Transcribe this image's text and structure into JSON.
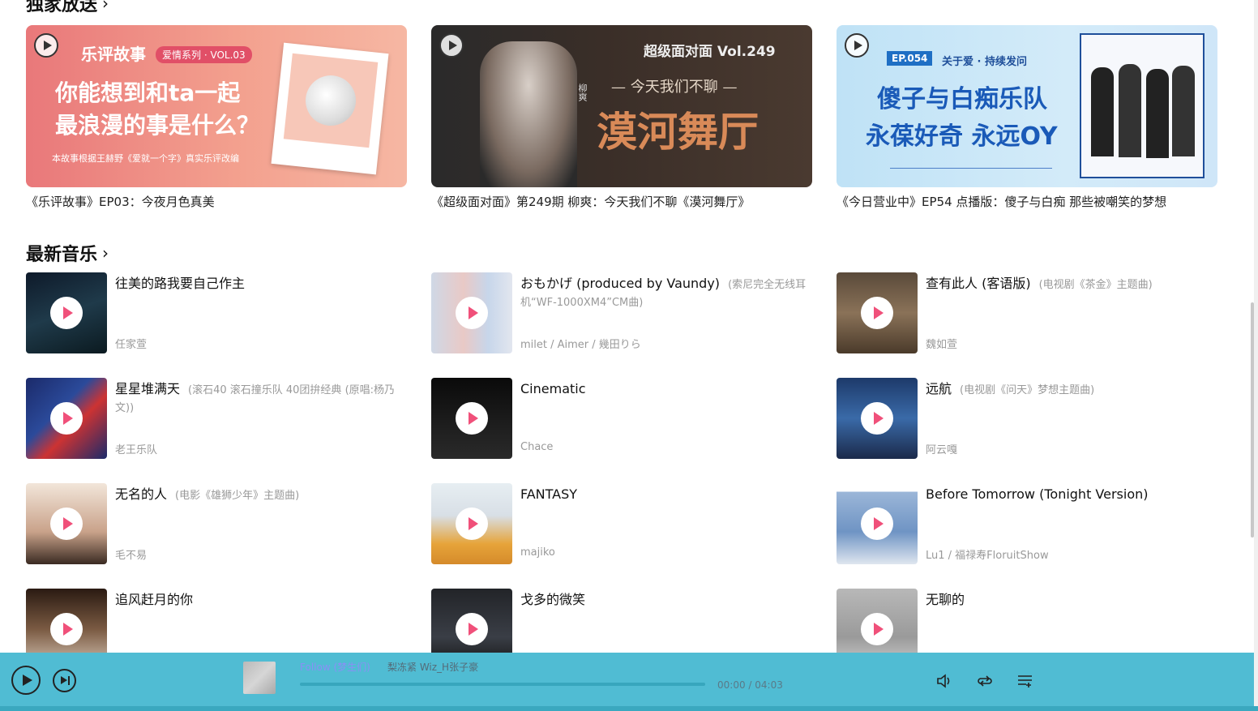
{
  "exclusive": {
    "title": "独家放送",
    "banners": [
      {
        "caption": "《乐评故事》EP03：今夜月色真美",
        "badge": "爱情系列 · VOL.03",
        "brand": "乐评故事",
        "line1": "你能想到和ta一起",
        "line2": "最浪漫的事是什么？",
        "note": "本故事根据王赫野《爱就一个字》真实乐评改编"
      },
      {
        "caption": "《超级面对面》第249期 柳爽：今天我们不聊《漠河舞厅》",
        "brand": "超级面对面 Vol.249",
        "line1": "— 今天我们不聊 —",
        "line2": "漠河舞厅",
        "name": "柳爽"
      },
      {
        "caption": "《今日营业中》EP54 点播版：傻子与白痴 那些被嘲笑的梦想",
        "badge": "EP.054",
        "tag": "关于爱 · 持续发问",
        "line1": "傻子与白痴乐队",
        "line2": "永葆好奇 永远OY"
      }
    ]
  },
  "newMusic": {
    "title": "最新音乐",
    "songs": [
      {
        "name": "往美的路我要自己作主",
        "sub": "",
        "artist": "任家萱"
      },
      {
        "name": "おもかげ (produced by Vaundy)",
        "sub": "(索尼完全无线耳机“WF-1000XM4”CM曲)",
        "artist": "milet / Aimer / 幾田りら"
      },
      {
        "name": "查有此人 (客语版)",
        "sub": "(电视剧《茶金》主题曲)",
        "artist": "魏如萱"
      },
      {
        "name": "星星堆满天",
        "sub": "(滚石40 滚石撞乐队 40团拚经典 (原唱:杨乃文))",
        "artist": "老王乐队"
      },
      {
        "name": "Cinematic",
        "sub": "",
        "artist": "Chace"
      },
      {
        "name": "远航",
        "sub": "(电视剧《问天》梦想主题曲)",
        "artist": "阿云嘎"
      },
      {
        "name": "无名的人",
        "sub": "(电影《雄狮少年》主题曲)",
        "artist": "毛不易"
      },
      {
        "name": "FANTASY",
        "sub": "",
        "artist": "majiko"
      },
      {
        "name": "Before Tomorrow (Tonight Version)",
        "sub": "",
        "artist": "Lu1 / 福禄寿FloruitShow"
      },
      {
        "name": "追风赶月的你",
        "sub": "",
        "artist": ""
      },
      {
        "name": "戈多的微笑",
        "sub": "",
        "artist": ""
      },
      {
        "name": "无聊的",
        "sub": "",
        "artist": ""
      }
    ]
  },
  "player": {
    "track": "Follow (梦生们)",
    "artists": "梨冻紧   Wiz_H张子豪",
    "time": "00:00 / 04:03",
    "progress": 0
  },
  "colors": {
    "accent": "#f0507a",
    "player_bg": "#50bcd3"
  }
}
